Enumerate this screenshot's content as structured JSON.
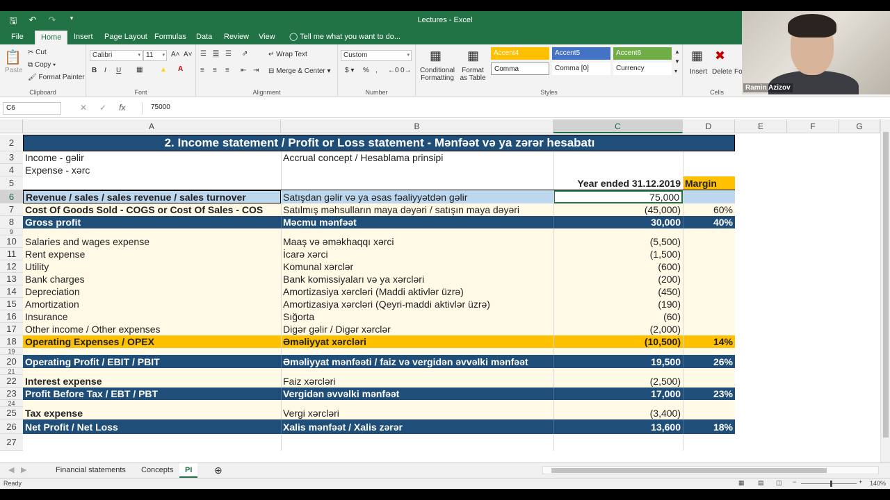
{
  "window": {
    "title": "Lectures - Excel",
    "tell_me": "Tell me what you want to do..."
  },
  "ribbon_tabs": [
    "File",
    "Home",
    "Insert",
    "Page Layout",
    "Formulas",
    "Data",
    "Review",
    "View"
  ],
  "ribbon": {
    "clipboard": {
      "paste": "Paste",
      "cut": "Cut",
      "copy": "Copy",
      "format_painter": "Format Painter",
      "label": "Clipboard"
    },
    "font": {
      "name": "Calibri",
      "size": "11",
      "bold": "B",
      "italic": "I",
      "underline": "U",
      "label": "Font"
    },
    "alignment": {
      "wrap": "Wrap Text",
      "merge": "Merge & Center",
      "label": "Alignment"
    },
    "number": {
      "format": "Custom",
      "label": "Number"
    },
    "styles": {
      "conditional": "Conditional Formatting",
      "format_table": "Format as Table",
      "cells": [
        {
          "label": "Accent4",
          "color": "#ffc000"
        },
        {
          "label": "Accent5",
          "color": "#4472c4"
        },
        {
          "label": "Accent6",
          "color": "#70ad47"
        },
        {
          "label": "Comma",
          "color": "#ffffff"
        },
        {
          "label": "Comma [0]",
          "color": "#ffffff"
        },
        {
          "label": "Currency",
          "color": "#ffffff"
        }
      ],
      "label": "Styles"
    },
    "cells_group": {
      "insert": "Insert",
      "delete": "Delete",
      "format": "Fo",
      "label": "Cells"
    }
  },
  "formula_bar": {
    "name_box": "C6",
    "formula": "75000"
  },
  "columns": [
    "A",
    "B",
    "C",
    "D",
    "E",
    "F",
    "G"
  ],
  "rows": [
    {
      "num": "2",
      "type": "title",
      "text": "2. Income statement  / Profit or Loss statement  -  Mənfəət və ya zərər hesabatı"
    },
    {
      "num": "3",
      "type": "plain",
      "a": "Income - gəlir",
      "b": "Accrual concept / Hesablama prinsipi",
      "c": "",
      "d": ""
    },
    {
      "num": "4",
      "type": "plain",
      "a": "Expense - xərc",
      "b": "",
      "c": "",
      "d": ""
    },
    {
      "num": "5",
      "type": "header",
      "a": "",
      "b": "",
      "c": "Year ended 31.12.2019",
      "d": "Margin"
    },
    {
      "num": "6",
      "type": "selected",
      "a": "Revenue / sales / sales revenue / sales turnover",
      "b": "Satışdan gəlir və ya əsas fəaliyyətdən gəlir",
      "c": "75,000",
      "d": ""
    },
    {
      "num": "7",
      "type": "boldA",
      "a": "Cost Of Goods Sold - COGS or Cost Of Sales - COS",
      "b": "Satılmış məhsulların maya dəyəri / satışın maya dəyəri",
      "c": "(45,000)",
      "d": "60%"
    },
    {
      "num": "8",
      "type": "dark",
      "a": "Gross profit",
      "b": "Məcmu mənfəət",
      "c": "30,000",
      "d": "40%"
    },
    {
      "num": "9",
      "type": "spacer",
      "a": "",
      "b": "",
      "c": "",
      "d": ""
    },
    {
      "num": "10",
      "type": "cream",
      "a": "Salaries and wages expense",
      "b": "Maaş və əməkhaqqı xərci",
      "c": "(5,500)",
      "d": ""
    },
    {
      "num": "11",
      "type": "cream",
      "a": "Rent expense",
      "b": "İcarə xərci",
      "c": "(1,500)",
      "d": ""
    },
    {
      "num": "12",
      "type": "cream",
      "a": "Utility",
      "b": "Komunal xərclər",
      "c": "(600)",
      "d": ""
    },
    {
      "num": "13",
      "type": "cream",
      "a": "Bank charges",
      "b": "Bank komissiyaları və ya xərcləri",
      "c": "(200)",
      "d": ""
    },
    {
      "num": "14",
      "type": "cream",
      "a": "Depreciation",
      "b": "Amortizasiya xərcləri (Maddi aktivlər üzrə)",
      "c": "(450)",
      "d": ""
    },
    {
      "num": "15",
      "type": "cream",
      "a": "Amortization",
      "b": "Amortizasiya xərcləri (Qeyri-maddi aktivlər üzrə)",
      "c": "(190)",
      "d": ""
    },
    {
      "num": "16",
      "type": "cream",
      "a": "Insurance",
      "b": "Sığorta",
      "c": "(60)",
      "d": ""
    },
    {
      "num": "17",
      "type": "cream",
      "a": "Other income / Other expenses",
      "b": "Digər gəlir / Digər xərclər",
      "c": "(2,000)",
      "d": ""
    },
    {
      "num": "18",
      "type": "orange",
      "a": "Operating Expenses / OPEX",
      "b": "Əməliyyat xərcləri",
      "c": "(10,500)",
      "d": "14%"
    },
    {
      "num": "19",
      "type": "spacer",
      "a": "",
      "b": "",
      "c": "",
      "d": ""
    },
    {
      "num": "20",
      "type": "dark",
      "a": "Operating Profit / EBIT / PBIT",
      "b": "Əməliyyat mənfəəti / faiz və vergidən əvvəlki mənfəət",
      "c": "19,500",
      "d": "26%"
    },
    {
      "num": "21",
      "type": "spacer",
      "a": "",
      "b": "",
      "c": "",
      "d": ""
    },
    {
      "num": "22",
      "type": "cream",
      "a": "Interest expense",
      "b": "Faiz xərcləri",
      "c": "(2,500)",
      "d": "",
      "boldA": true
    },
    {
      "num": "23",
      "type": "dark",
      "a": "Profit Before Tax / EBT / PBT",
      "b": "Vergidən əvvəlki mənfəət",
      "c": "17,000",
      "d": "23%"
    },
    {
      "num": "24",
      "type": "spacer",
      "a": "",
      "b": "",
      "c": "",
      "d": ""
    },
    {
      "num": "25",
      "type": "cream",
      "a": "Tax expense",
      "b": "Vergi xərcləri",
      "c": "(3,400)",
      "d": "",
      "boldA": true
    },
    {
      "num": "26",
      "type": "dark",
      "a": "Net Profit / Net Loss",
      "b": "Xalis mənfəət / Xalis zərər",
      "c": "13,600",
      "d": "18%"
    },
    {
      "num": "27",
      "type": "plain",
      "a": "",
      "b": "",
      "c": "",
      "d": ""
    }
  ],
  "sheet_tabs": [
    "Financial statements",
    "Concepts",
    "PI"
  ],
  "active_sheet": "PI",
  "status": {
    "ready": "Ready",
    "zoom": "140%"
  },
  "webcam": {
    "name": "Ramin Azizov"
  }
}
